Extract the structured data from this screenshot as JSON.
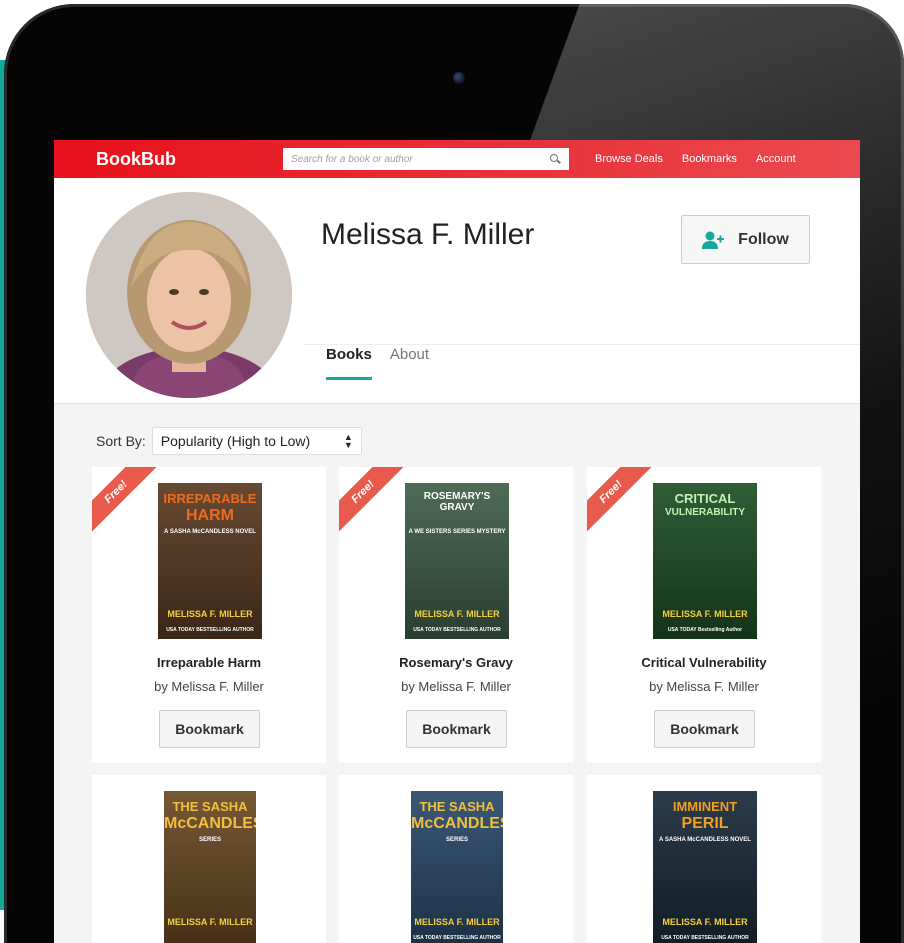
{
  "nav": {
    "logo": "BookBub",
    "search_placeholder": "Search for a book or author",
    "links": [
      "Browse Deals",
      "Bookmarks",
      "Account"
    ]
  },
  "profile": {
    "name": "Melissa F. Miller",
    "follow_label": "Follow",
    "tabs": [
      {
        "label": "Books",
        "active": true
      },
      {
        "label": "About",
        "active": false
      }
    ]
  },
  "sort": {
    "label": "Sort By:",
    "selected": "Popularity (High to Low)"
  },
  "books": [
    {
      "title": "Irreparable Harm",
      "author": "by Melissa F. Miller",
      "badge": "Free!",
      "bookmark_label": "Bookmark",
      "cover": {
        "line1": "IRREPARABLE",
        "line2": "HARM",
        "tagline": "A SASHA McCANDLESS NOVEL",
        "author": "MELISSA F. MILLER",
        "footer": "USA TODAY BESTSELLING AUTHOR",
        "bg": "#5a3b22",
        "accent": "#ef6a1f"
      }
    },
    {
      "title": "Rosemary's Gravy",
      "author": "by Melissa F. Miller",
      "badge": "Free!",
      "bookmark_label": "Bookmark",
      "cover": {
        "line1": "ROSEMARY'S GRAVY",
        "line2": "",
        "tagline": "A WE SISTERS SERIES MYSTERY",
        "author": "MELISSA F. MILLER",
        "footer": "USA TODAY BESTSELLING AUTHOR",
        "bg": "#3f5f4a",
        "accent": "#ffffff"
      }
    },
    {
      "title": "Critical Vulnerability",
      "author": "by Melissa F. Miller",
      "badge": "Free!",
      "bookmark_label": "Bookmark",
      "cover": {
        "line1": "CRITICAL",
        "line2": "VULNERABILITY",
        "tagline": "",
        "author": "MELISSA F. MILLER",
        "footer": "USA TODAY Bestselling Author",
        "bg": "#1f4f25",
        "accent": "#c8f0b0"
      }
    },
    {
      "title": "",
      "author": "",
      "badge": "",
      "bookmark_label": "",
      "cover": {
        "line1": "THE SASHA",
        "line2": "McCANDLESS",
        "tagline": "SERIES",
        "author": "MELISSA F. MILLER",
        "footer": "",
        "bg": "#6a4a24",
        "accent": "#f0c040"
      }
    },
    {
      "title": "",
      "author": "",
      "badge": "",
      "bookmark_label": "",
      "cover": {
        "line1": "THE SASHA",
        "line2": "McCANDLESS",
        "tagline": "SERIES",
        "author": "MELISSA F. MILLER",
        "footer": "USA TODAY BESTSELLING AUTHOR",
        "bg": "#2a4a6a",
        "accent": "#f0c040"
      }
    },
    {
      "title": "",
      "author": "",
      "badge": "",
      "bookmark_label": "",
      "cover": {
        "line1": "IMMINENT",
        "line2": "PERIL",
        "tagline": "A SASHA McCANDLESS NOVEL",
        "author": "MELISSA F. MILLER",
        "footer": "USA TODAY BESTSELLING AUTHOR",
        "bg": "#1a2b3a",
        "accent": "#f0a020"
      }
    }
  ]
}
